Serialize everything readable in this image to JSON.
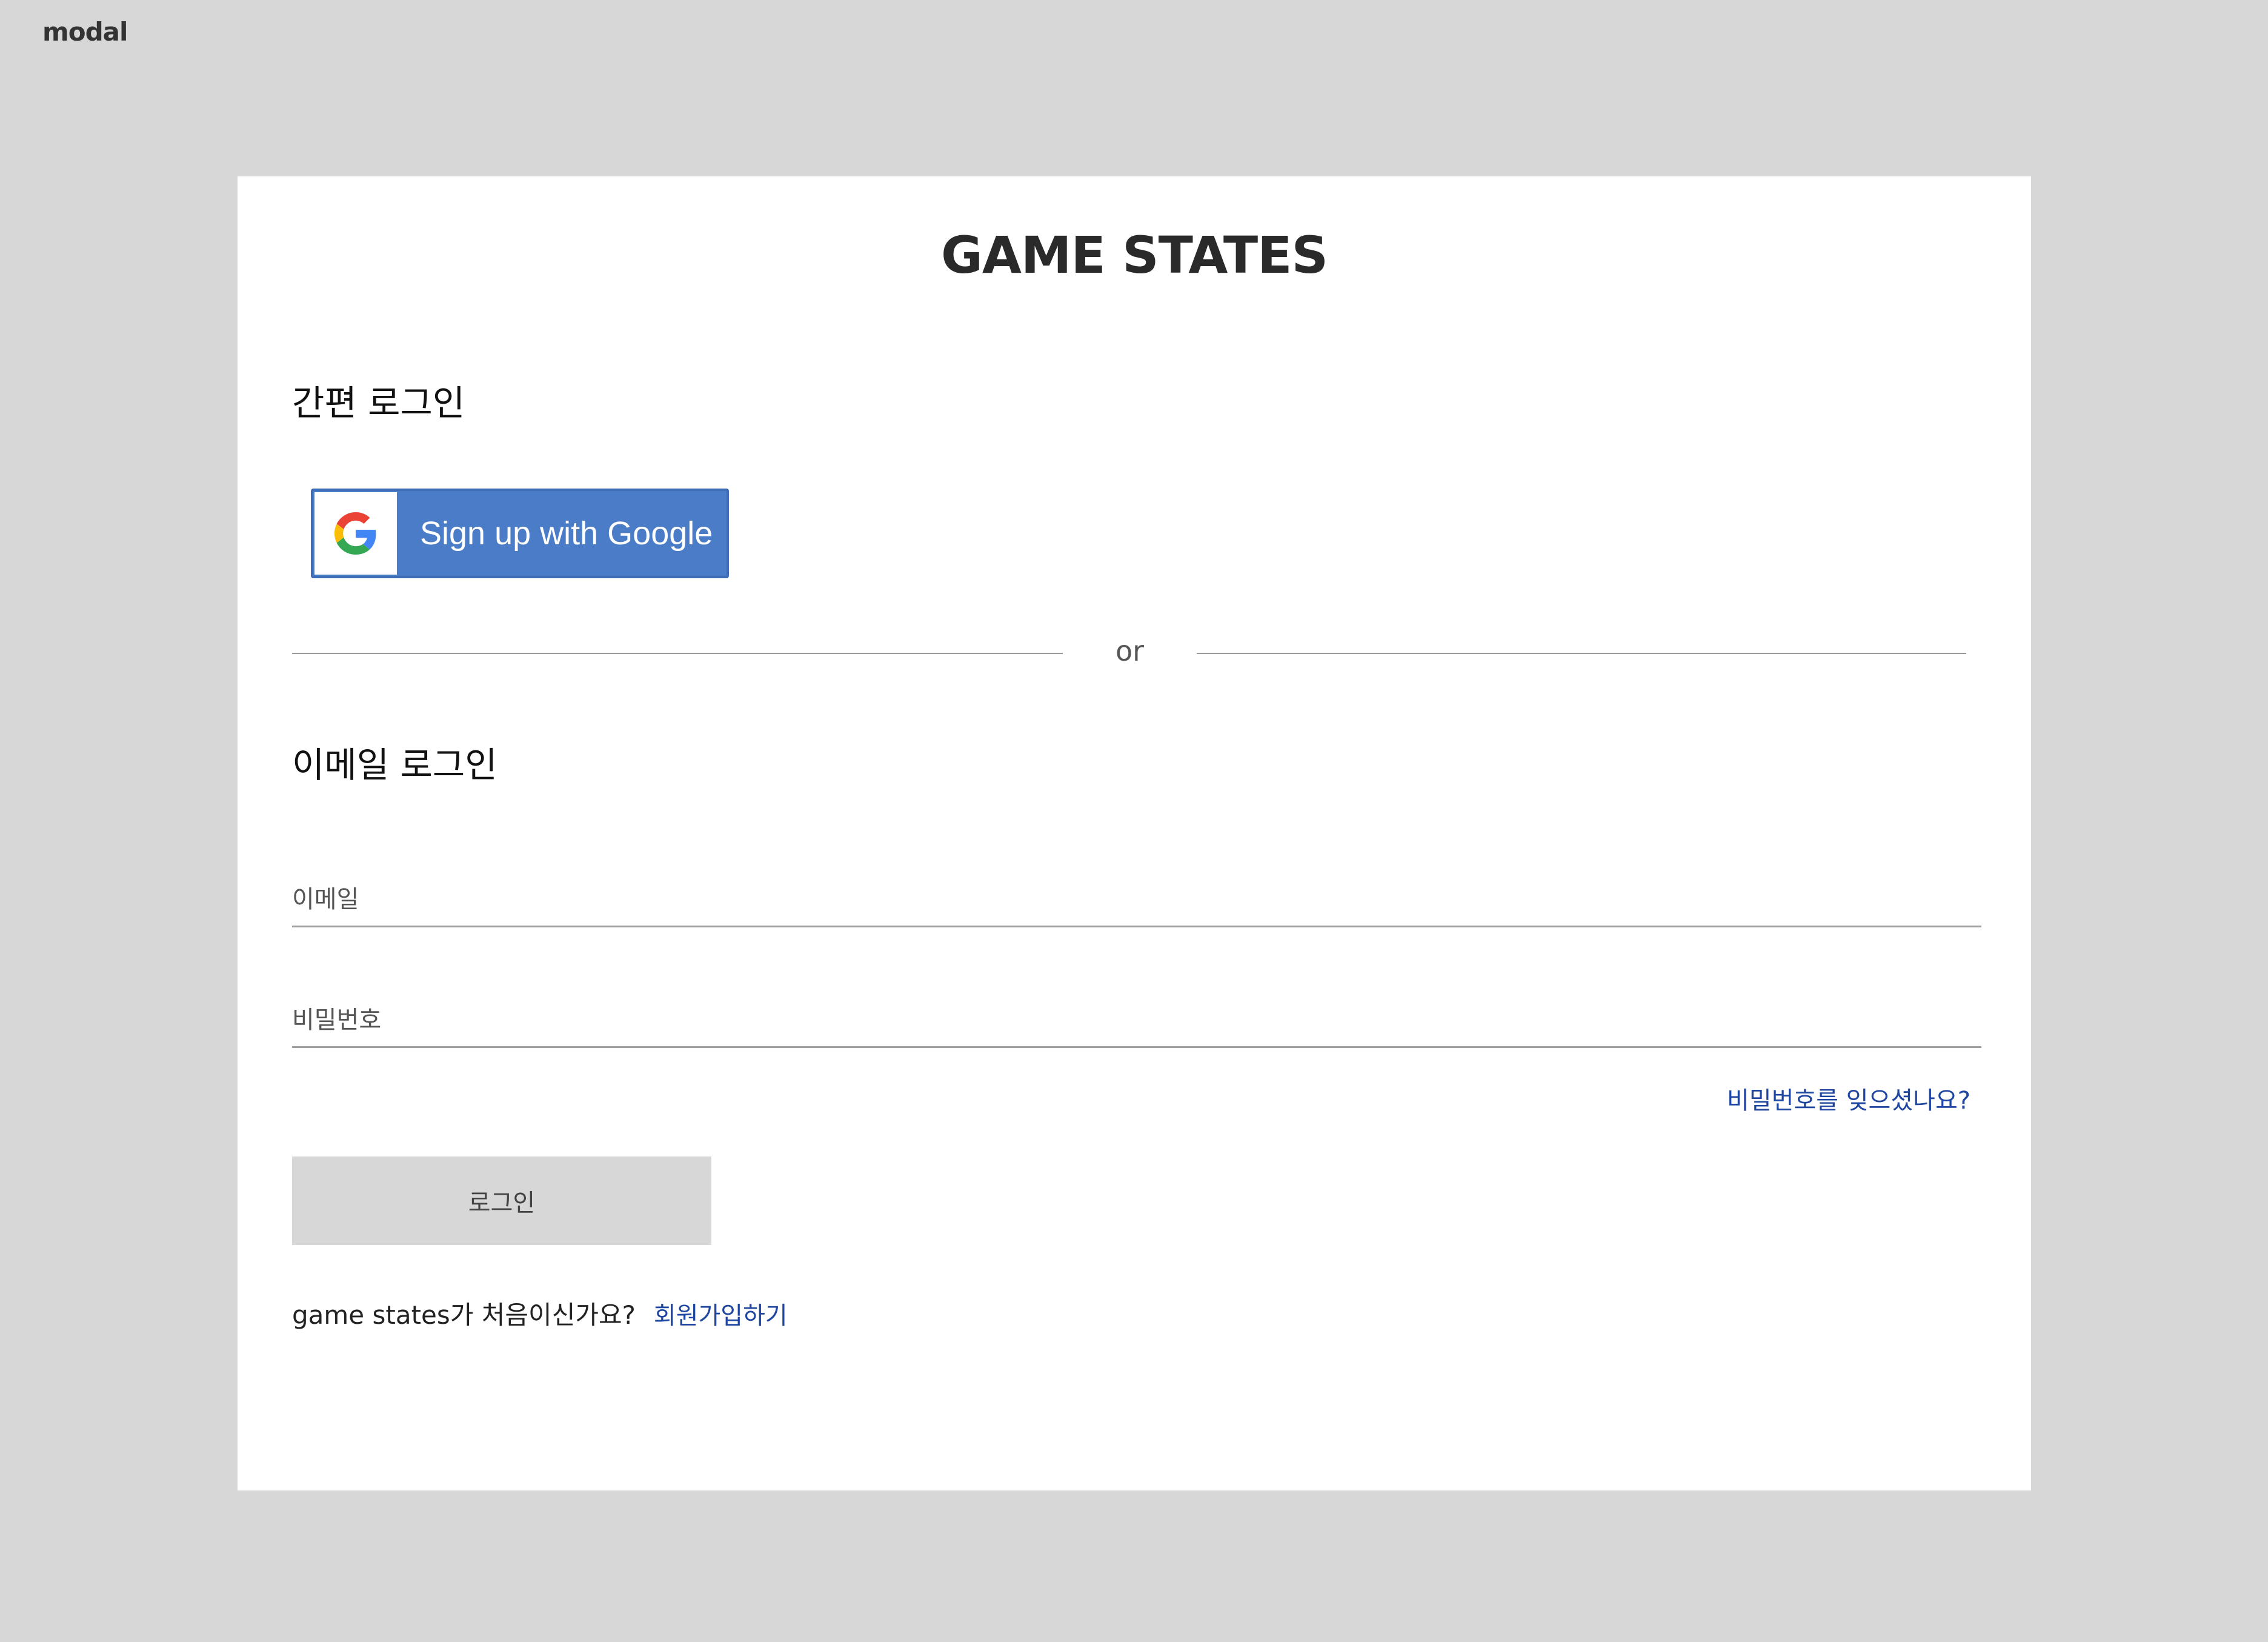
{
  "frame": {
    "label": "modal"
  },
  "modal": {
    "title": "GAME STATES",
    "quick_login": {
      "heading": "간편 로그인",
      "google_button_label": "Sign up with Google"
    },
    "divider_text": "or",
    "email_login": {
      "heading": "이메일 로그인",
      "email_placeholder": "이메일",
      "password_placeholder": "비밀번호",
      "forgot_password_label": "비밀번호를 잊으셨나요?",
      "login_button_label": "로그인"
    },
    "signup": {
      "prompt": "game states가 처음이신가요?",
      "link_label": "회원가입하기"
    }
  },
  "colors": {
    "background": "#d7d7d7",
    "modal": "#ffffff",
    "google_blue": "#4a7cc7",
    "link_blue": "#1f46a0",
    "login_button": "#d7d7d7"
  },
  "icons": {
    "google": "google-g-icon"
  }
}
